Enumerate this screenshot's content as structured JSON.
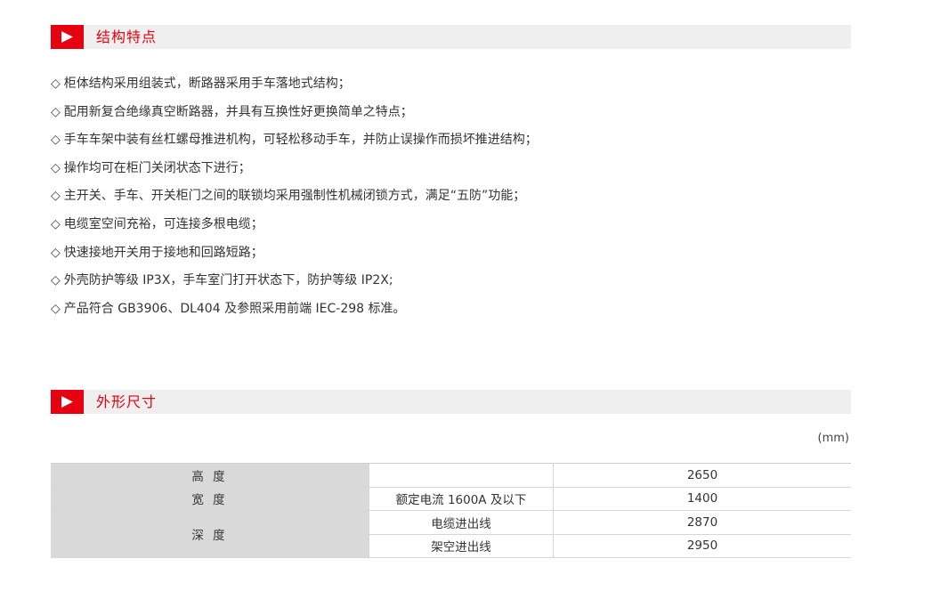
{
  "colors": {
    "accent": "#e60012",
    "bar_bg": "#efefef",
    "label_bg": "#d9d9d9"
  },
  "sections": {
    "features_title": "结构特点",
    "dimensions_title": "外形尺寸"
  },
  "features": {
    "marker": "◇",
    "items": [
      "柜体结构采用组装式，断路器采用手车落地式结构；",
      "配用新复合绝缘真空断路器，并具有互换性好更换简单之特点；",
      "手车车架中装有丝杠螺母推进机构，可轻松移动手车，并防止误操作而损坏推进结构；",
      "操作均可在柜门关闭状态下进行；",
      "主开关、手车、开关柜门之间的联锁均采用强制性机械闭锁方式，满足“五防”功能；",
      "电缆室空间充裕，可连接多根电缆；",
      "快速接地开关用于接地和回路短路；",
      "外壳防护等级 IP3X，手车室门打开状态下，防护等级 IP2X;",
      "产品符合 GB3906、DL404 及参照采用前端 IEC-298 标准。"
    ]
  },
  "dimensions": {
    "unit": "(mm)",
    "rows": [
      {
        "label": "高  度",
        "condition": "",
        "value": "2650"
      },
      {
        "label": "宽  度",
        "condition": "额定电流 1600A 及以下",
        "value": "1400"
      },
      {
        "label": "深  度",
        "condition": "电缆进出线",
        "value": "2870"
      },
      {
        "label": "",
        "condition": "架空进出线",
        "value": "2950"
      }
    ]
  }
}
